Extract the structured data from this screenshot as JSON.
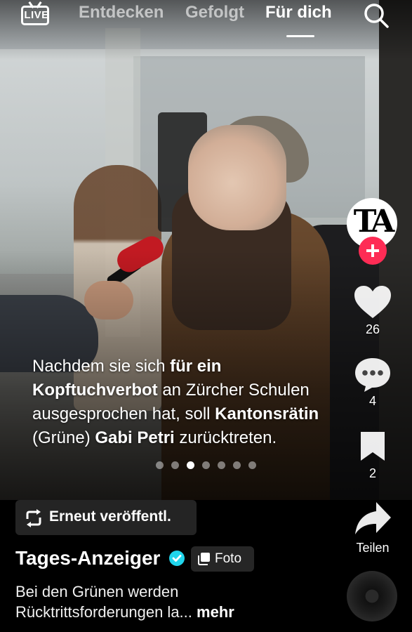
{
  "top_nav": {
    "live_label": "LIVE",
    "tabs": [
      {
        "label": "Entdecken",
        "active": false
      },
      {
        "label": "Gefolgt",
        "active": false
      },
      {
        "label": "Für dich",
        "active": true
      }
    ],
    "search_icon": "search-icon"
  },
  "post": {
    "caption": {
      "line1_a": "Nachdem sie sich ",
      "line1_b": "für ein",
      "line2_a": "Kopftuchverbot",
      "line2_b": " an Zürcher Schulen",
      "line3_a": "ausgesprochen hat, soll ",
      "line3_b": "Kantonsrätin",
      "line4_a": "(Grüne) ",
      "line4_b": "Gabi Petri",
      "line4_c": " zurücktreten."
    },
    "carousel": {
      "total": 7,
      "active_index": 2
    },
    "author": "Tages-Anzeiger",
    "author_monogram": "TA",
    "verified": true,
    "media_type_label": "Foto",
    "repost_label": "Erneut veröffentl.",
    "description": "Bei den Grünen werden Rücktrittsforderungen la...",
    "more_label": "mehr"
  },
  "actions": {
    "likes": "26",
    "comments": "4",
    "saves": "2",
    "share_label": "Teilen"
  },
  "colors": {
    "follow_accent": "#fe2c55",
    "verified": "#20d5ec"
  }
}
